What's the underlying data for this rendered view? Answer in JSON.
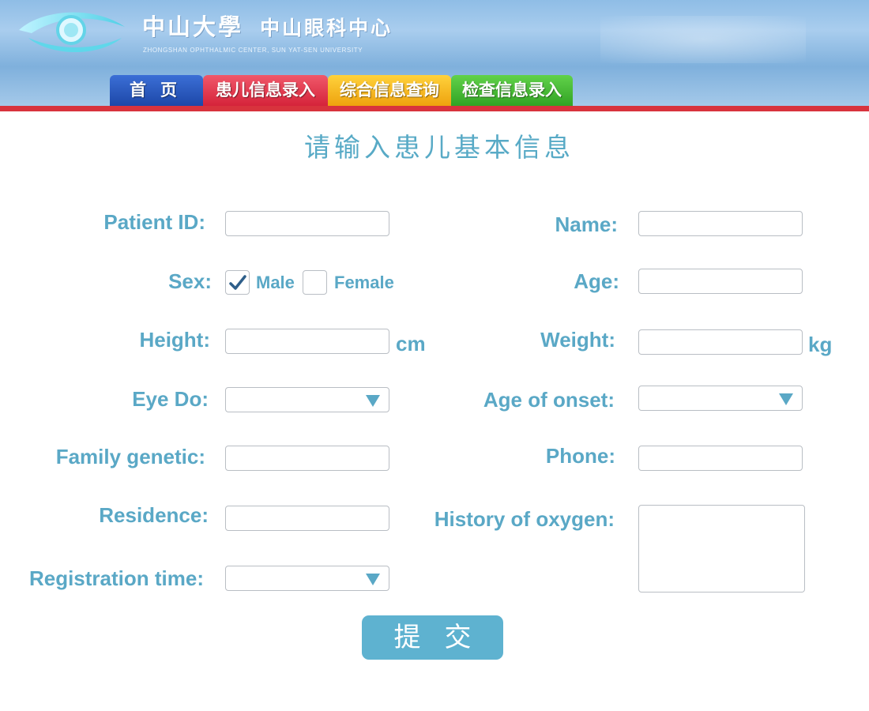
{
  "header": {
    "university_title": "中山大學",
    "center_title": "中山眼科中心",
    "subtitle": "ZHONGSHAN OPHTHALMIC CENTER, SUN YAT-SEN UNIVERSITY"
  },
  "nav": {
    "tabs": [
      {
        "label": "首页",
        "color": "#2a58c4"
      },
      {
        "label": "患儿信息录入",
        "color": "#e23a4e"
      },
      {
        "label": "综合信息查询",
        "color": "#f4b61f"
      },
      {
        "label": "检查信息录入",
        "color": "#46bb35"
      }
    ]
  },
  "page_title": "请输入患儿基本信息",
  "form": {
    "patient_id": {
      "label": "Patient ID:",
      "value": ""
    },
    "name": {
      "label": "Name:",
      "value": ""
    },
    "sex": {
      "label": "Sex:",
      "options": [
        {
          "label": "Male",
          "checked": true
        },
        {
          "label": "Female",
          "checked": false
        }
      ]
    },
    "age": {
      "label": "Age:",
      "value": ""
    },
    "height": {
      "label": "Height:",
      "value": "",
      "unit": "cm"
    },
    "weight": {
      "label": "Weight:",
      "value": "",
      "unit": "kg"
    },
    "eye_do": {
      "label": "Eye Do:",
      "value": ""
    },
    "age_of_onset": {
      "label": "Age of onset:",
      "value": ""
    },
    "family_genetic": {
      "label": "Family genetic:",
      "value": ""
    },
    "phone": {
      "label": "Phone:",
      "value": ""
    },
    "residence": {
      "label": "Residence:",
      "value": ""
    },
    "history_of_oxygen": {
      "label": "History of oxygen:",
      "value": ""
    },
    "registration_time": {
      "label": "Registration time:",
      "value": ""
    },
    "submit_label": "提交"
  },
  "colors": {
    "accent": "#5aa8c6",
    "header_red_line": "#d8333d",
    "checkmark": "#2e5f8a"
  }
}
